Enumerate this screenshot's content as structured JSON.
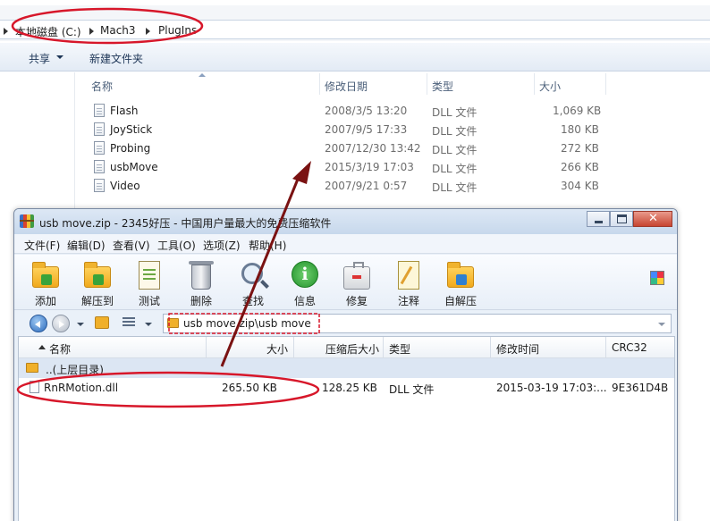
{
  "explorer": {
    "breadcrumb": [
      "本地磁盘 (C:)",
      "Mach3",
      "PlugIns"
    ],
    "toolbar": {
      "share": "共享",
      "new_folder": "新建文件夹"
    },
    "columns": {
      "name": "名称",
      "modified": "修改日期",
      "type": "类型",
      "size": "大小"
    },
    "files": [
      {
        "name": "Flash",
        "modified": "2008/3/5 13:20",
        "type": "DLL 文件",
        "size": "1,069 KB"
      },
      {
        "name": "JoyStick",
        "modified": "2007/9/5 17:33",
        "type": "DLL 文件",
        "size": "180 KB"
      },
      {
        "name": "Probing",
        "modified": "2007/12/30 13:42",
        "type": "DLL 文件",
        "size": "272 KB"
      },
      {
        "name": "usbMove",
        "modified": "2015/3/19 17:03",
        "type": "DLL 文件",
        "size": "266 KB"
      },
      {
        "name": "Video",
        "modified": "2007/9/21 0:57",
        "type": "DLL 文件",
        "size": "304 KB"
      }
    ]
  },
  "zip_window": {
    "title": "usb move.zip - 2345好压 - 中国用户量最大的免费压缩软件",
    "menu": [
      "文件(F)",
      "编辑(D)",
      "查看(V)",
      "工具(O)",
      "选项(Z)",
      "帮助(H)"
    ],
    "tools": [
      "添加",
      "解压到",
      "测试",
      "删除",
      "查找",
      "信息",
      "修复",
      "注释",
      "自解压"
    ],
    "path": "usb move.zip\\usb move",
    "columns": {
      "name": "名称",
      "size": "大小",
      "packed": "压缩后大小",
      "type": "类型",
      "modified": "修改时间",
      "crc": "CRC32"
    },
    "parent_row": "..(上层目录)",
    "files": [
      {
        "name": "RnRMotion.dll",
        "size": "265.50 KB",
        "packed": "128.25 KB",
        "type": "DLL 文件",
        "modified": "2015-03-19 17:03:...",
        "crc": "9E361D4B"
      }
    ]
  },
  "icons": {
    "window_close": "close-icon",
    "window_max": "maximize-icon",
    "window_min": "minimize-icon",
    "back": "back-arrow-icon",
    "forward": "forward-arrow-icon"
  },
  "colors": {
    "annotation_red": "#d7172a",
    "arrow_darkred": "#7a1212",
    "close_red": "#c74531"
  }
}
